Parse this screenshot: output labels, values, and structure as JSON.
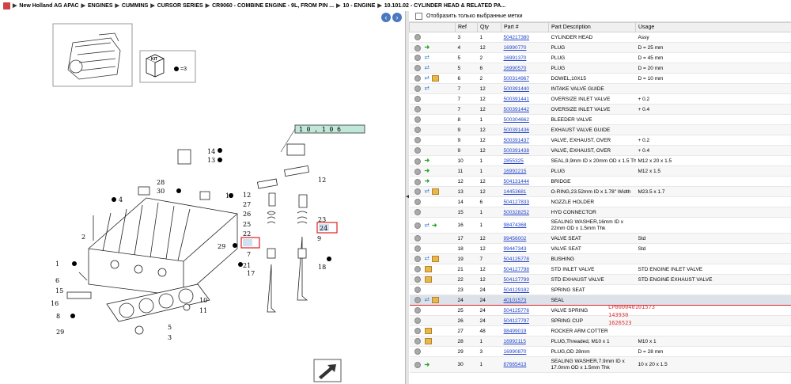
{
  "breadcrumb": [
    "New Holland AG APAC",
    "ENGINES",
    "CUMMINS",
    "CURSOR SERIES",
    "CR9060 - COMBINE ENGINE - 9L, FROM PIN ...",
    "10 - ENGINE",
    "10.101.02 - CYLINDER HEAD & RELATED PA..."
  ],
  "filter": {
    "label": "Отобразить только выбранные метки"
  },
  "columns": [
    "Ref",
    "Qty",
    "Part #",
    "Part Description",
    "Usage"
  ],
  "rows": [
    {
      "icons": [
        "o"
      ],
      "ref": "3",
      "qty": "1",
      "part": "504217380",
      "desc": "CYLINDER HEAD",
      "usage": "Assy"
    },
    {
      "icons": [
        "o",
        "arrow"
      ],
      "ref": "4",
      "qty": "12",
      "part": "16990770",
      "desc": "PLUG",
      "usage": "D = 25 mm"
    },
    {
      "icons": [
        "o",
        "drop"
      ],
      "ref": "5",
      "qty": "2",
      "part": "16991370",
      "desc": "PLUG",
      "usage": "D = 45 mm"
    },
    {
      "icons": [
        "o",
        "drop"
      ],
      "ref": "5",
      "qty": "6",
      "part": "16990570",
      "desc": "PLUG",
      "usage": "D = 20 mm"
    },
    {
      "icons": [
        "o",
        "drop",
        "box"
      ],
      "ref": "6",
      "qty": "2",
      "part": "500314967",
      "desc": "DOWEL,10X15",
      "usage": "D = 10 mm"
    },
    {
      "icons": [
        "o",
        "drop"
      ],
      "ref": "7",
      "qty": "12",
      "part": "500391440",
      "desc": "INTAKE VALVE GUIDE",
      "usage": ""
    },
    {
      "icons": [
        "o"
      ],
      "ref": "7",
      "qty": "12",
      "part": "500391441",
      "desc": "OVERSIZE INLET VALVE",
      "usage": "+ 0.2"
    },
    {
      "icons": [
        "o"
      ],
      "ref": "7",
      "qty": "12",
      "part": "500391442",
      "desc": "OVERSIZE INLET VALVE",
      "usage": "+ 0.4"
    },
    {
      "icons": [
        "o"
      ],
      "ref": "8",
      "qty": "1",
      "part": "500304662",
      "desc": "BLEEDER VALVE",
      "usage": ""
    },
    {
      "icons": [
        "o"
      ],
      "ref": "9",
      "qty": "12",
      "part": "500391436",
      "desc": "EXHAUST VALVE GUIDE",
      "usage": ""
    },
    {
      "icons": [
        "o"
      ],
      "ref": "9",
      "qty": "12",
      "part": "500391437",
      "desc": "VALVE, EXHAUST, OVER",
      "usage": "+ 0.2"
    },
    {
      "icons": [
        "o"
      ],
      "ref": "9",
      "qty": "12",
      "part": "500391438",
      "desc": "VALVE, EXHAUST, OVER",
      "usage": "+ 0.4"
    },
    {
      "icons": [
        "o",
        "arrow"
      ],
      "ref": "10",
      "qty": "1",
      "part": "2855325",
      "desc": "SEAL,9,9mm ID x 20mm OD x 1.5 Thk",
      "usage": "M12 x 20 x 1.5"
    },
    {
      "icons": [
        "o",
        "arrow"
      ],
      "ref": "11",
      "qty": "1",
      "part": "16992215",
      "desc": "PLUG",
      "usage": "M12 x 1.5"
    },
    {
      "icons": [
        "o",
        "arrow"
      ],
      "ref": "12",
      "qty": "12",
      "part": "504131444",
      "desc": "BRIDGE",
      "usage": ""
    },
    {
      "icons": [
        "o",
        "drop",
        "box"
      ],
      "ref": "13",
      "qty": "12",
      "part": "14453681",
      "desc": "O-RING,23.52mm ID x 1.78\" Width",
      "usage": "M23.5 x 1.7"
    },
    {
      "icons": [
        "o"
      ],
      "ref": "14",
      "qty": "6",
      "part": "504127833",
      "desc": "NOZZLE HOLDER",
      "usage": ""
    },
    {
      "icons": [
        "o"
      ],
      "ref": "15",
      "qty": "1",
      "part": "500328252",
      "desc": "HYD CONNECTOR",
      "usage": ""
    },
    {
      "icons": [
        "o",
        "drop",
        "arrow"
      ],
      "ref": "16",
      "qty": "1",
      "part": "98474368",
      "desc": "SEALING WASHER,16mm ID x 22mm OD x 1.5mm Thk",
      "usage": "",
      "tall": true
    },
    {
      "icons": [
        "o"
      ],
      "ref": "17",
      "qty": "12",
      "part": "99456002",
      "desc": "VALVE SEAT",
      "usage": "Std"
    },
    {
      "icons": [
        "o"
      ],
      "ref": "18",
      "qty": "12",
      "part": "99447343",
      "desc": "VALVE SEAT",
      "usage": "Std"
    },
    {
      "icons": [
        "o",
        "drop",
        "box"
      ],
      "ref": "19",
      "qty": "7",
      "part": "504125778",
      "desc": "BUSHING",
      "usage": ""
    },
    {
      "icons": [
        "o",
        "box"
      ],
      "ref": "21",
      "qty": "12",
      "part": "504127798",
      "desc": "STD INLET VALVE",
      "usage": "STD ENGINE INLET VALVE"
    },
    {
      "icons": [
        "o",
        "box"
      ],
      "ref": "22",
      "qty": "12",
      "part": "504127799",
      "desc": "STD EXHAUST VALVE",
      "usage": "STD ENGINE EXHAUST VALVE"
    },
    {
      "icons": [
        "o"
      ],
      "ref": "23",
      "qty": "24",
      "part": "504129182",
      "desc": "SPRING SEAT",
      "usage": ""
    },
    {
      "icons": [
        "o",
        "drop",
        "box"
      ],
      "ref": "24",
      "qty": "24",
      "part": "40101573",
      "desc": "SEAL",
      "usage": "",
      "selected": true
    },
    {
      "icons": [
        "o"
      ],
      "ref": "25",
      "qty": "24",
      "part": "504125776",
      "desc": "VALVE SPRING",
      "usage": ""
    },
    {
      "icons": [
        "o"
      ],
      "ref": "26",
      "qty": "24",
      "part": "504127797",
      "desc": "SPRING CUP",
      "usage": ""
    },
    {
      "icons": [
        "o",
        "box"
      ],
      "ref": "27",
      "qty": "48",
      "part": "98499019",
      "desc": "ROCKER ARM COTTER",
      "usage": ""
    },
    {
      "icons": [
        "o",
        "box"
      ],
      "ref": "28",
      "qty": "1",
      "part": "16992115",
      "desc": "PLUG,Threaded, M10 x 1",
      "usage": "M10 x 1"
    },
    {
      "icons": [
        "o"
      ],
      "ref": "29",
      "qty": "3",
      "part": "16990870",
      "desc": "PLUG,OD 28mm",
      "usage": "D = 28 mm"
    },
    {
      "icons": [
        "o",
        "arrow"
      ],
      "ref": "30",
      "qty": "1",
      "part": "87665413",
      "desc": "SEALING WASHER,7.9mm ID x 17.0mm OD x 1.5mm Thk",
      "usage": "10 x 20 x 1.5",
      "tall": true
    }
  ],
  "annotations": [
    "LP000040101573",
    "143930",
    "1626523"
  ],
  "diagram": {
    "callout_top": "1 0 , 1 0 6",
    "kit_label": "KIT",
    "kit_qty": "=3",
    "labels": [
      "14",
      "13",
      "28",
      "30",
      "4",
      "19",
      "2",
      "29",
      "1",
      "6",
      "15",
      "16",
      "8",
      "29",
      "10",
      "11",
      "5",
      "3",
      "12",
      "27",
      "26",
      "25",
      "22",
      "21",
      "7",
      "17",
      "12",
      "23",
      "24",
      "9",
      "18"
    ]
  }
}
